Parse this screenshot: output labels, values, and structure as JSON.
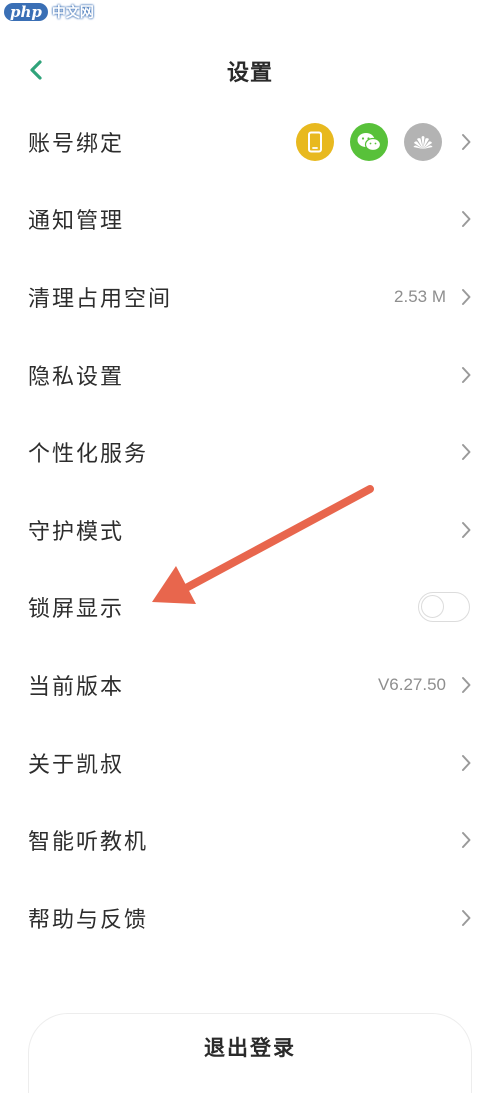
{
  "watermark": {
    "logo": "php",
    "text": "中文网"
  },
  "header": {
    "title": "设置"
  },
  "accent_color": "#2fa37a",
  "settings": [
    {
      "label": "账号绑定",
      "type": "accounts"
    },
    {
      "label": "通知管理",
      "type": "chevron"
    },
    {
      "label": "清理占用空间",
      "type": "value",
      "value": "2.53 M"
    },
    {
      "label": "隐私设置",
      "type": "chevron"
    },
    {
      "label": "个性化服务",
      "type": "chevron"
    },
    {
      "label": "守护模式",
      "type": "chevron"
    },
    {
      "label": "锁屏显示",
      "type": "toggle",
      "toggle_on": false
    },
    {
      "label": "当前版本",
      "type": "value",
      "value": "V6.27.50"
    },
    {
      "label": "关于凯叔",
      "type": "chevron"
    },
    {
      "label": "智能听教机",
      "type": "chevron"
    },
    {
      "label": "帮助与反馈",
      "type": "chevron"
    }
  ],
  "account_bindings": [
    {
      "name": "phone-icon",
      "color": "#e8b91f"
    },
    {
      "name": "wechat-icon",
      "color": "#58c13a"
    },
    {
      "name": "huawei-icon",
      "color": "#b3b3b3"
    }
  ],
  "logout_label": "退出登录"
}
